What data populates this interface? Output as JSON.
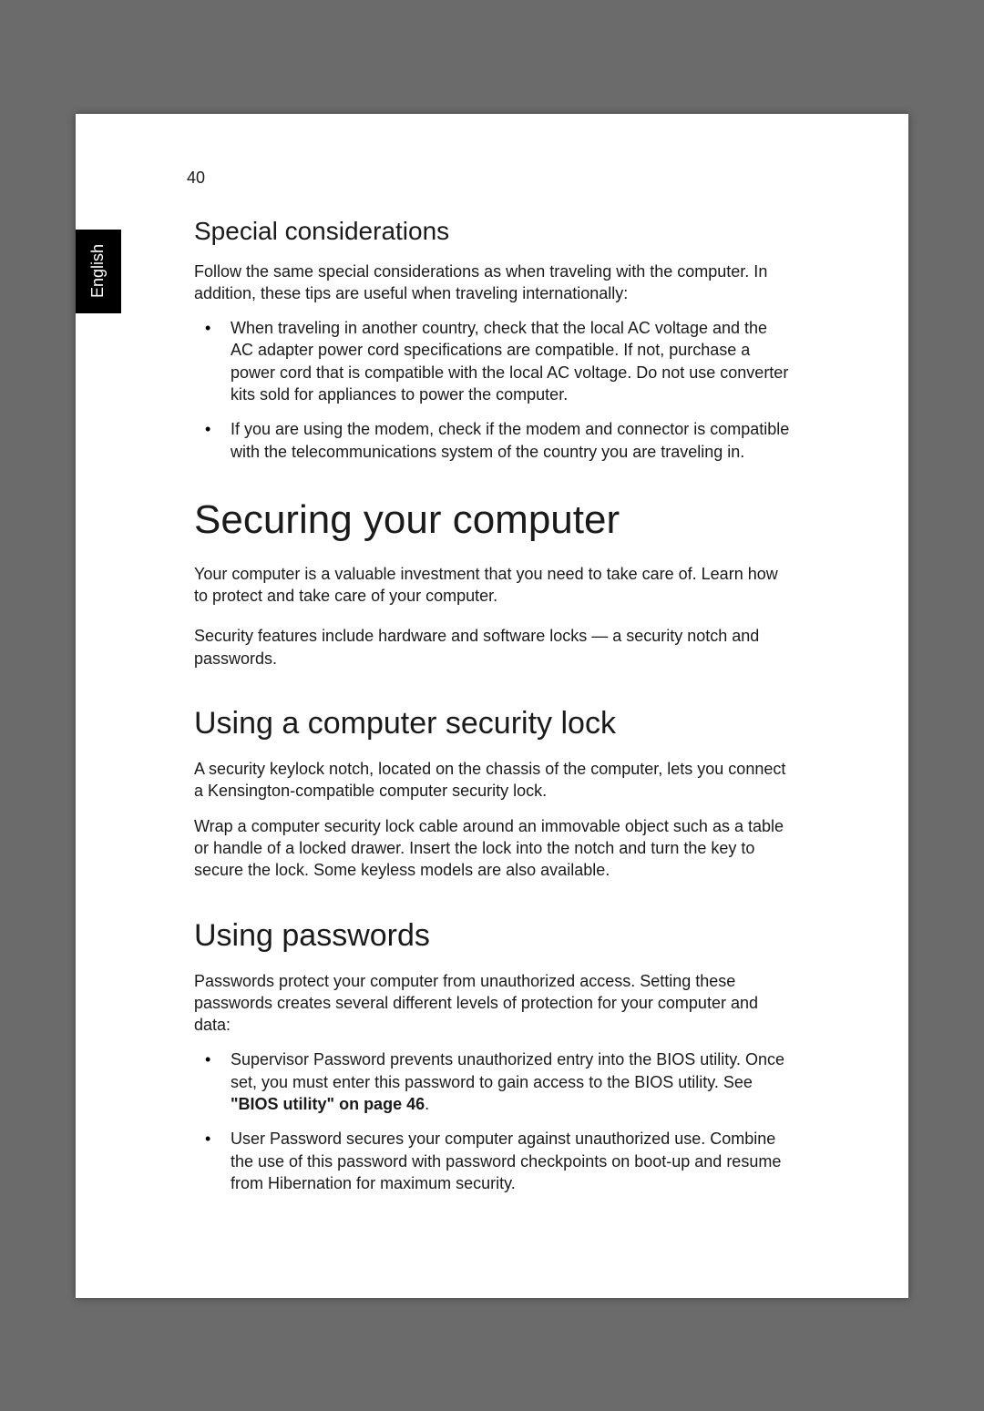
{
  "page_number": "40",
  "side_tab": "English",
  "section1": {
    "heading": "Special considerations",
    "intro": "Follow the same special considerations as when traveling with the computer. In addition, these tips are useful when traveling internationally:",
    "bullets": [
      "When traveling in another country, check that the local AC voltage and the AC adapter power cord specifications are compatible. If not, purchase a power cord that is compatible with the local AC voltage. Do not use converter kits sold for appliances to power the computer.",
      "If you are using the modem, check if the modem and connector is compatible with the telecommunications system of the country you are traveling in."
    ]
  },
  "section2": {
    "heading": "Securing your computer",
    "p1": "Your computer is a valuable investment that you need to take care of. Learn how to protect and take care of your computer.",
    "p2": "Security features include hardware and software locks — a security notch and passwords."
  },
  "section3": {
    "heading": "Using a computer security lock",
    "p1": "A security keylock notch, located on the chassis of the computer, lets you connect a Kensington-compatible computer security lock.",
    "p2": "Wrap a computer security lock cable around an immovable object such as a table or handle of a locked drawer. Insert the lock into the notch and turn the key to secure the lock. Some keyless models are also available."
  },
  "section4": {
    "heading": "Using passwords",
    "intro": "Passwords protect your computer from unauthorized access. Setting these passwords creates several different levels of protection for your computer and data:",
    "bullet1_pre": "Supervisor Password prevents unauthorized entry into the BIOS utility. Once set, you must enter this password to gain access to the BIOS utility. See ",
    "bullet1_ref": "\"BIOS utility\" on page 46",
    "bullet1_post": ".",
    "bullet2": "User Password secures your computer against unauthorized use. Combine the use of this password with password checkpoints on boot-up and resume from Hibernation for maximum security."
  }
}
